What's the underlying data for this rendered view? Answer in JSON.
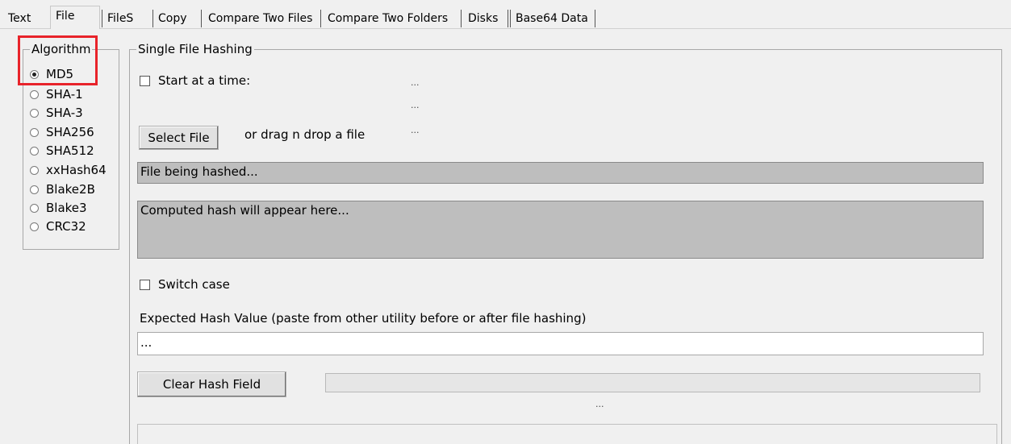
{
  "tabs": [
    {
      "label": "Text"
    },
    {
      "label": "File",
      "active": true
    },
    {
      "label": "FileS"
    },
    {
      "label": "Copy"
    },
    {
      "label": "Compare Two Files"
    },
    {
      "label": "Compare Two Folders"
    },
    {
      "label": "Disks"
    },
    {
      "label": "Base64 Data"
    }
  ],
  "algorithm": {
    "title": "Algorithm",
    "selected": "MD5",
    "highlight_color": "#e8232a",
    "options": [
      "MD5",
      "SHA-1",
      "SHA-3",
      "SHA256",
      "SHA512",
      "xxHash64",
      "Blake2B",
      "Blake3",
      "CRC32"
    ]
  },
  "single": {
    "title": "Single File Hashing",
    "start_at_time_label": "Start at a time:",
    "dots1": "...",
    "dots2": "...",
    "dots3": "...",
    "select_file_label": "Select File",
    "drag_hint": "or drag n drop a file",
    "file_being_hashed": "File being hashed...",
    "computed_hash": "Computed hash will appear here...",
    "switch_case_label": "Switch case",
    "expected_label": "Expected Hash Value (paste from other utility before or after file hashing)",
    "expected_value": "...",
    "clear_label": "Clear Hash Field",
    "bottom_dots": "..."
  },
  "colors": {
    "background": "#f0f0f0",
    "field_gray": "#bebebe",
    "field_white": "#ffffff"
  }
}
